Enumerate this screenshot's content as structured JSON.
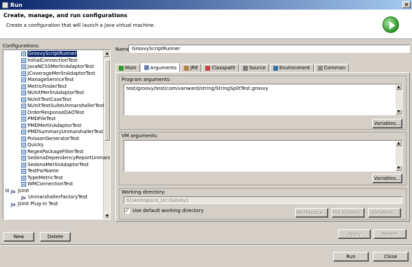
{
  "window": {
    "title": "Run"
  },
  "header": {
    "title": "Create, manage, and run configurations",
    "description": "Create a configuration that will launch a Java virtual machine."
  },
  "left": {
    "label": "Configurations:",
    "items": [
      {
        "label": "GroovyScriptRunner",
        "selected": true
      },
      {
        "label": "InitialConnectionTest"
      },
      {
        "label": "JavaNCSSMerlinAdaptorTest"
      },
      {
        "label": "JCoverageMerlinAdaptorTest"
      },
      {
        "label": "ManageServiceTest"
      },
      {
        "label": "MetricFinderTest"
      },
      {
        "label": "NUnitMerlinAdaptorTest"
      },
      {
        "label": "NUnitTestCaseTest"
      },
      {
        "label": "NUnitTestSuiteUnmarshallerTest"
      },
      {
        "label": "OrderResponseDAOTest"
      },
      {
        "label": "PMDFileTest"
      },
      {
        "label": "PMDMerlinAdaptorTest"
      },
      {
        "label": "PMDSummaryUnmarshallerTest"
      },
      {
        "label": "PoissonGeneratorTest"
      },
      {
        "label": "Quicky"
      },
      {
        "label": "RegexPackageFilterTest"
      },
      {
        "label": "SedonaDependencyReportUnmarsl"
      },
      {
        "label": "SedonaMerlinAdaptorTest"
      },
      {
        "label": "TestForName"
      },
      {
        "label": "TypeMetricTest"
      },
      {
        "label": "WMConnectionTest"
      }
    ],
    "groups": [
      {
        "label": "JUnit",
        "icon": "Ju"
      },
      {
        "label": "UnmarshallerFactoryTest",
        "icon": "Ju"
      },
      {
        "label": "JUnit Plug-in Test",
        "icon": "Ju"
      }
    ],
    "new_label": "New",
    "delete_label": "Delete"
  },
  "form": {
    "name_label": "Name:",
    "name_value": "GroovyScriptRunner",
    "tabs": [
      {
        "label": "Main",
        "color": "#2e9a28"
      },
      {
        "label": "Arguments",
        "color": "#6a7fb0",
        "active": true
      },
      {
        "label": "JRE",
        "color": "#b08040"
      },
      {
        "label": "Classpath",
        "color": "#c04040"
      },
      {
        "label": "Source",
        "color": "#7a7a7a"
      },
      {
        "label": "Environment",
        "color": "#3a6ea5"
      },
      {
        "label": "Common",
        "color": "#8a8a8a"
      }
    ],
    "program_args_label": "Program arguments:",
    "program_args_value": "test/groovy/test/com/vanward/string/StringSplitTest.groovy",
    "vm_args_label": "VM arguments:",
    "variables_label": "Variables...",
    "working_dir_label": "Working directory:",
    "working_dir_value": "${workspace_loc:Galvey}",
    "use_default_label": "Use default working directory",
    "use_default_checked": true,
    "workspace_label": "Workspace...",
    "filesystem_label": "File System...",
    "variables2_label": "Variables...",
    "apply_label": "Apply",
    "revert_label": "Revert"
  },
  "footer": {
    "run_label": "Run",
    "close_label": "Close"
  }
}
